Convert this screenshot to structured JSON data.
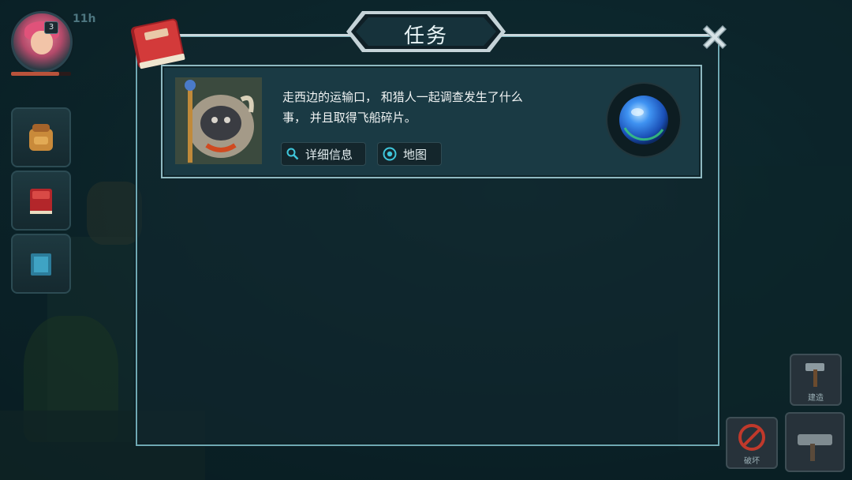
{
  "title": "任务",
  "hud": {
    "level": "3",
    "time": "11h",
    "build_label": "建造",
    "demolish_label": "破坏"
  },
  "quest": {
    "description": "走西边的运输口， 和猎人一起调查发生了什么事， 并且取得飞船碎片。",
    "details_button": "详细信息",
    "map_button": "地图"
  },
  "icons": {
    "close": "close-icon",
    "book": "quest-book-icon",
    "search": "search-icon",
    "map_target": "target-icon",
    "orb": "blue-orb-icon"
  },
  "colors": {
    "panel_border": "#6fa9b3",
    "card_bg": "#1a3a44",
    "accent_cyan": "#3fc7dc",
    "orb_blue": "#2c7ee8"
  }
}
